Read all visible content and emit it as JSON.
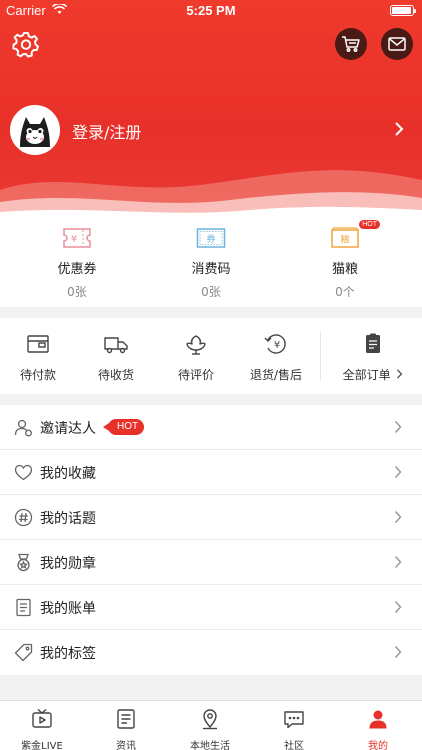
{
  "status_bar": {
    "carrier": "Carrier",
    "time": "5:25 PM",
    "battery_level": 0.95
  },
  "header": {
    "login_label": "登录/注册"
  },
  "wallet": [
    {
      "name": "优惠券",
      "count": "0张",
      "icon": "coupon-icon"
    },
    {
      "name": "消费码",
      "count": "0张",
      "icon": "voucher-icon"
    },
    {
      "name": "猫粮",
      "count": "0个",
      "icon": "cat-food-icon",
      "badge": "HOT"
    }
  ],
  "orders": {
    "items": [
      {
        "label": "待付款",
        "icon": "wallet-icon"
      },
      {
        "label": "待收货",
        "icon": "truck-icon"
      },
      {
        "label": "待评价",
        "icon": "flower-icon"
      },
      {
        "label": "退货/售后",
        "icon": "refund-icon"
      }
    ],
    "all_label": "全部订单"
  },
  "menu": [
    {
      "label": "邀请达人",
      "icon": "invite-icon",
      "badge": "HOT"
    },
    {
      "label": "我的收藏",
      "icon": "heart-icon"
    },
    {
      "label": "我的话题",
      "icon": "hashtag-icon"
    },
    {
      "label": "我的勋章",
      "icon": "medal-icon"
    },
    {
      "label": "我的账单",
      "icon": "bill-icon"
    },
    {
      "label": "我的标签",
      "icon": "tag-icon"
    }
  ],
  "tabbar": [
    {
      "label": "紫金LIVE",
      "icon": "live-tv-icon",
      "active": false
    },
    {
      "label": "资讯",
      "icon": "news-icon",
      "active": false
    },
    {
      "label": "本地生活",
      "icon": "location-icon",
      "active": false
    },
    {
      "label": "社区",
      "icon": "community-icon",
      "active": false
    },
    {
      "label": "我的",
      "icon": "profile-icon",
      "active": true
    }
  ],
  "colors": {
    "brand_red": "#e8302a",
    "dark_button": "#4a1a15"
  }
}
